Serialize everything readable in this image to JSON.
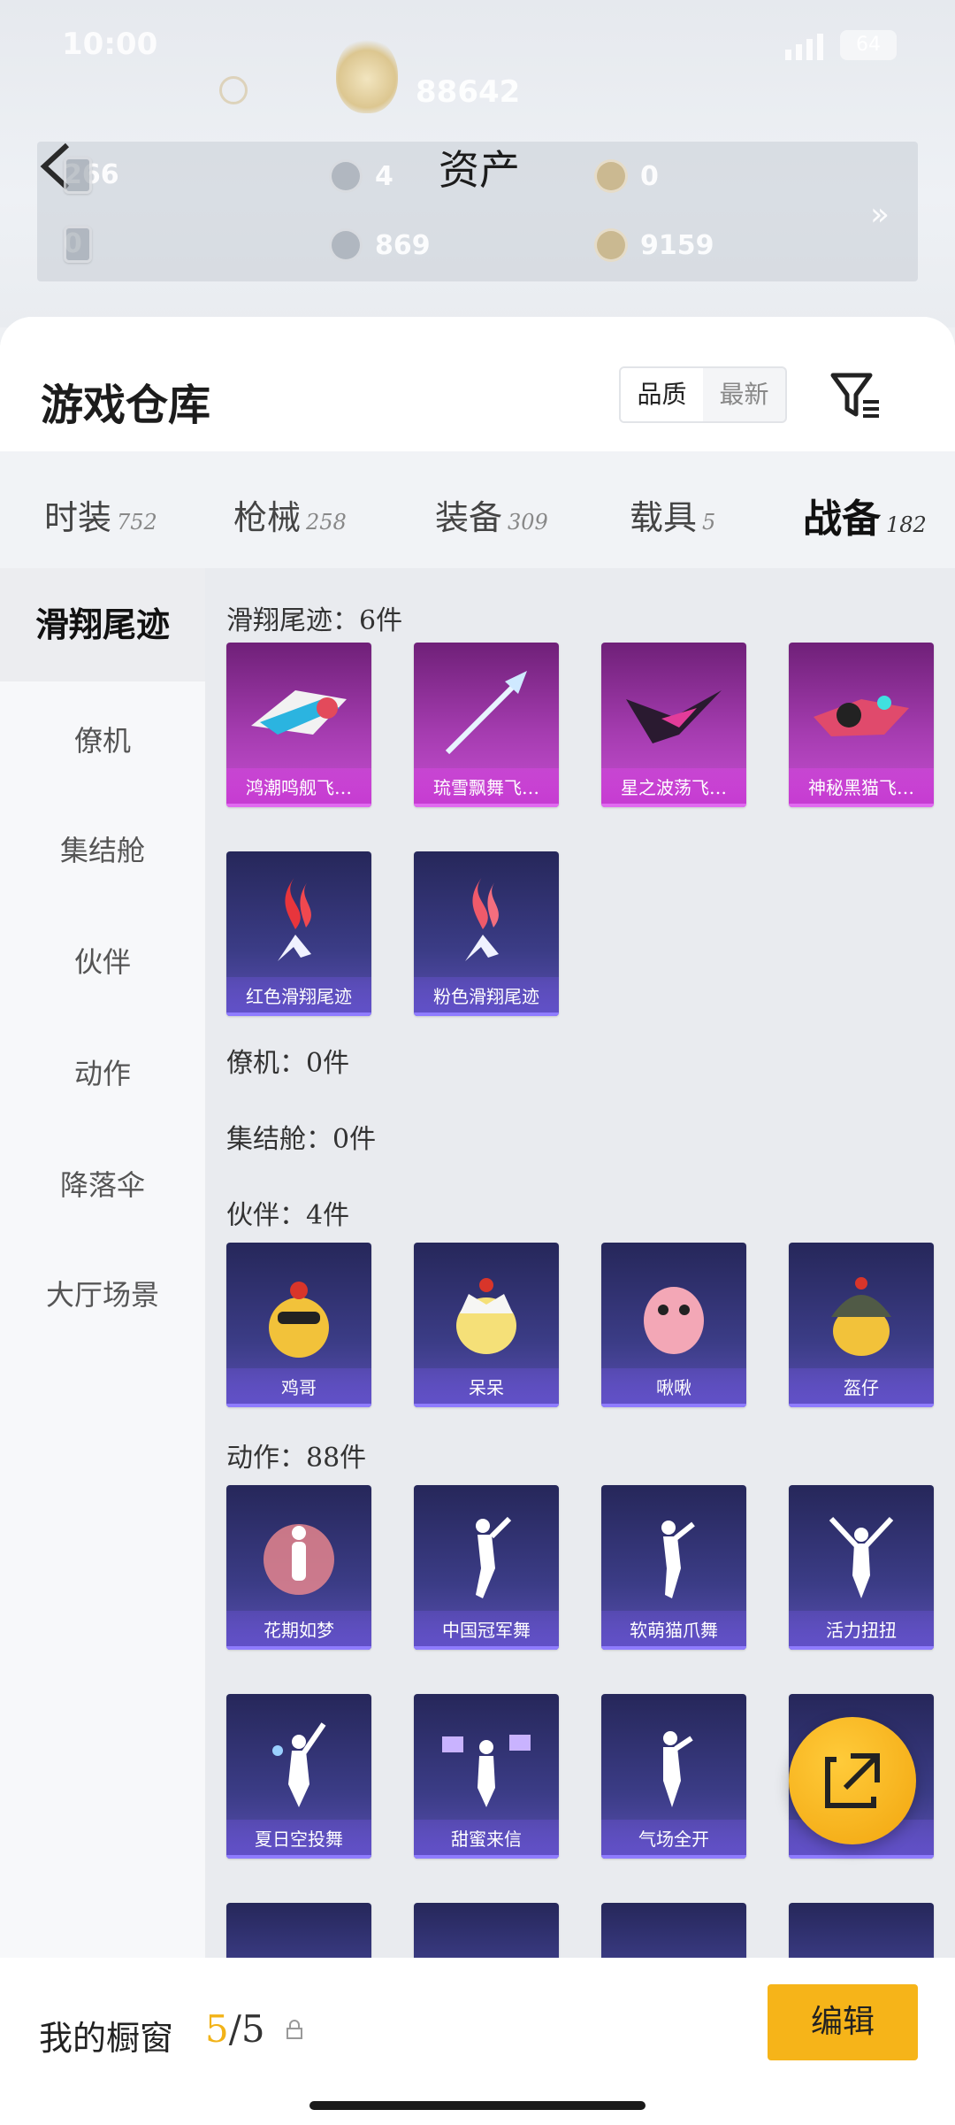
{
  "status": {
    "time": "10:00",
    "battery": "64"
  },
  "header": {
    "score": "88642",
    "asset_title": "资产"
  },
  "assets": [
    {
      "icon": "card-icon",
      "value": "266"
    },
    {
      "icon": "silver-coin-icon",
      "value": "4"
    },
    {
      "icon": "gold-coin-icon",
      "value": "0"
    },
    {
      "icon": "ticket-icon",
      "value": "0"
    },
    {
      "icon": "silver-token-icon",
      "value": "869"
    },
    {
      "icon": "gold-token-icon",
      "value": "9159"
    }
  ],
  "sheet": {
    "title": "游戏仓库",
    "sort_options": [
      "品质",
      "最新"
    ],
    "sort_selected": "品质"
  },
  "tabs": [
    {
      "label": "时装",
      "count": "752"
    },
    {
      "label": "枪械",
      "count": "258"
    },
    {
      "label": "装备",
      "count": "309"
    },
    {
      "label": "载具",
      "count": "5"
    },
    {
      "label": "战备",
      "count": "182",
      "active": true
    }
  ],
  "sidebar": [
    "滑翔尾迹",
    "僚机",
    "集结舱",
    "伙伴",
    "动作",
    "降落伞",
    "大厅场景"
  ],
  "sections": [
    {
      "label": "滑翔尾迹：6件",
      "items": [
        {
          "name": "鸿潮鸣舰飞…",
          "rarity": "purple"
        },
        {
          "name": "琉雪飘舞飞…",
          "rarity": "purple"
        },
        {
          "name": "星之波荡飞…",
          "rarity": "purple"
        },
        {
          "name": "神秘黑猫飞…",
          "rarity": "purple"
        },
        {
          "name": "红色滑翔尾迹",
          "rarity": "indigo"
        },
        {
          "name": "粉色滑翔尾迹",
          "rarity": "indigo"
        }
      ]
    },
    {
      "label": "僚机：0件",
      "items": []
    },
    {
      "label": "集结舱：0件",
      "items": []
    },
    {
      "label": "伙伴：4件",
      "items": [
        {
          "name": "鸡哥",
          "rarity": "indigo"
        },
        {
          "name": "呆呆",
          "rarity": "indigo"
        },
        {
          "name": "啾啾",
          "rarity": "indigo"
        },
        {
          "name": "盔仔",
          "rarity": "indigo"
        }
      ]
    },
    {
      "label": "动作：88件",
      "items": [
        {
          "name": "花期如梦",
          "rarity": "indigo"
        },
        {
          "name": "中国冠军舞",
          "rarity": "indigo"
        },
        {
          "name": "软萌猫爪舞",
          "rarity": "indigo"
        },
        {
          "name": "活力扭扭",
          "rarity": "indigo"
        },
        {
          "name": "夏日空投舞",
          "rarity": "indigo"
        },
        {
          "name": "甜蜜来信",
          "rarity": "indigo"
        },
        {
          "name": "气场全开",
          "rarity": "indigo"
        },
        {
          "name": "",
          "rarity": "indigo"
        }
      ]
    }
  ],
  "showcase": {
    "label": "我的橱窗",
    "current": "5",
    "total": "/5",
    "edit_label": "编辑"
  }
}
